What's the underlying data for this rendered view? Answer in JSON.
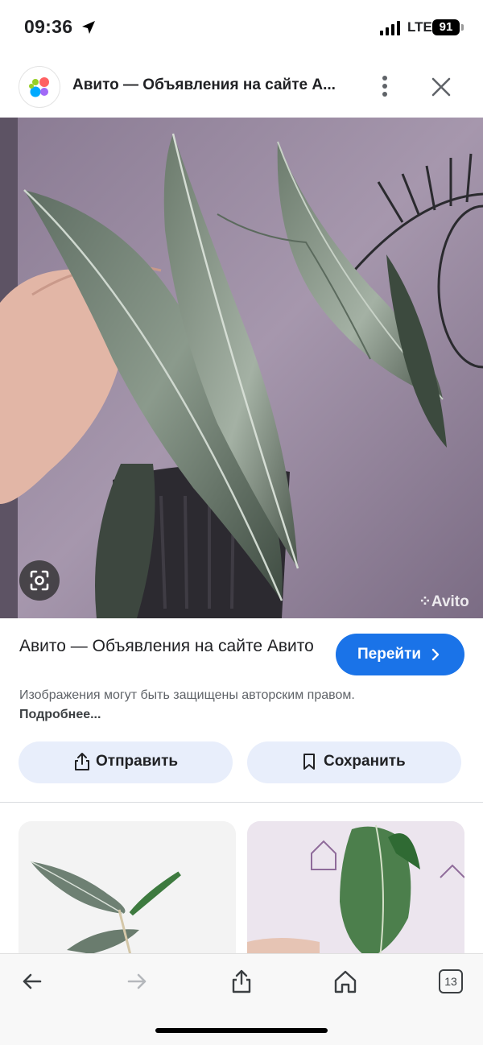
{
  "status_bar": {
    "time": "09:36",
    "network": "LTE",
    "battery": "91"
  },
  "header": {
    "title": "Авито — Объявления на сайте А..."
  },
  "image": {
    "watermark": "Avito"
  },
  "result": {
    "title": "Авито — Объявления на сайте Авито",
    "goto_label": "Перейти",
    "copyright_text": "Изображения могут быть защищены авторским правом.",
    "more_link": "Подробнее..."
  },
  "actions": {
    "share_label": "Отправить",
    "save_label": "Сохранить"
  },
  "bottom_bar": {
    "tabs_count": "13"
  },
  "colors": {
    "accent": "#1a73e8",
    "action_bg": "#e8eefb"
  }
}
